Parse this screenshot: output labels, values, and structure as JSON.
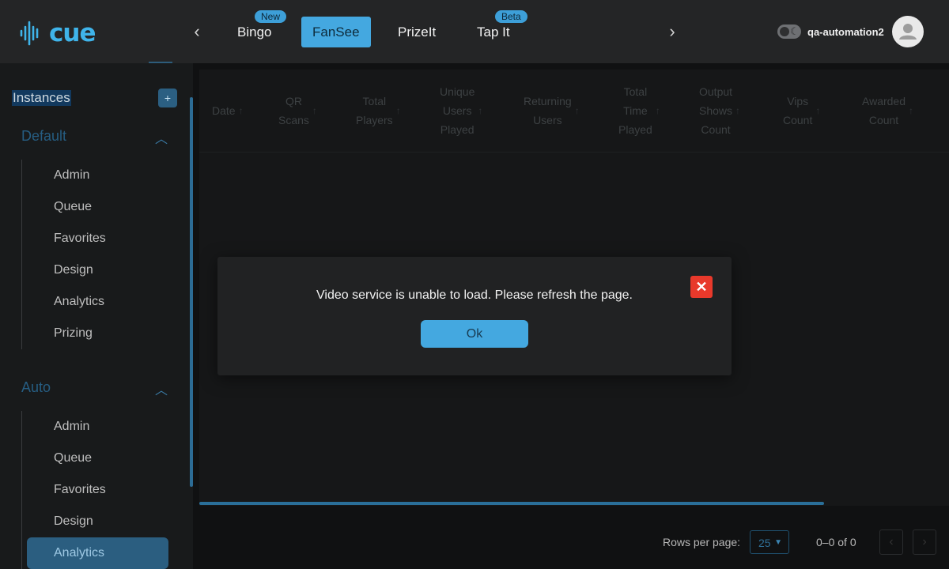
{
  "app": {
    "logo_text": "cue",
    "username": "qa-automation2"
  },
  "colors": {
    "accent": "#44a8e0",
    "danger": "#e8392b",
    "header_bg": "#242526"
  },
  "header": {
    "tabs": [
      {
        "label": "Bingo",
        "badge": "New"
      },
      {
        "label": "FanSee",
        "badge": ""
      },
      {
        "label": "PrizeIt",
        "badge": ""
      },
      {
        "label": "Tap It",
        "badge": "Beta"
      }
    ],
    "active_tab": "FanSee"
  },
  "sidebar": {
    "instances_label": "Instances",
    "add_label": "+",
    "groups": [
      {
        "title": "Default",
        "items": [
          "Admin",
          "Queue",
          "Favorites",
          "Design",
          "Analytics",
          "Prizing"
        ]
      },
      {
        "title": "Auto",
        "items": [
          "Admin",
          "Queue",
          "Favorites",
          "Design",
          "Analytics"
        ]
      }
    ],
    "active_item": "Auto / Analytics"
  },
  "table": {
    "columns": [
      [
        "Date"
      ],
      [
        "QR",
        "Scans"
      ],
      [
        "Total",
        "Players"
      ],
      [
        "Unique",
        "Users",
        "Played"
      ],
      [
        "Returning",
        "Users"
      ],
      [
        "Total",
        "Time",
        "Played"
      ],
      [
        "Output",
        "Shows",
        "Count"
      ],
      [
        "Vips",
        "Count"
      ],
      [
        "Awarded",
        "Count"
      ]
    ]
  },
  "pagination": {
    "rows_per_page_label": "Rows per page:",
    "rows_per_page_value": "25",
    "range": "0–0 of 0"
  },
  "modal": {
    "message": "Video service is unable to load. Please refresh the page.",
    "ok_label": "Ok",
    "close_icon": "close-icon"
  }
}
